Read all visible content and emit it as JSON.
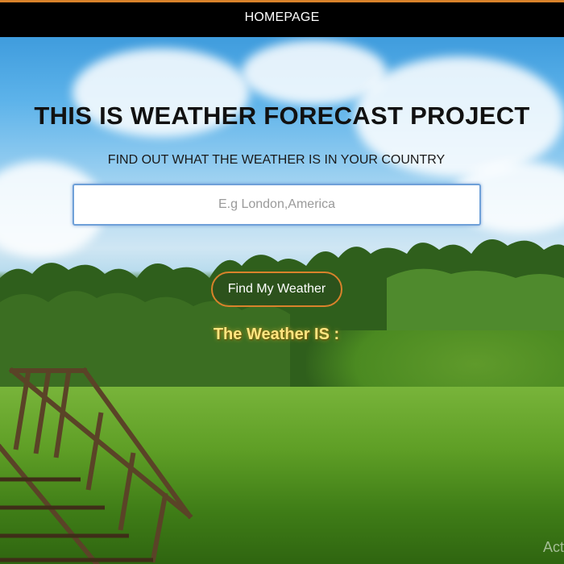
{
  "nav": {
    "home_label": "HOMEPAGE"
  },
  "hero": {
    "title": "THIS IS WEATHER FORECAST PROJECT",
    "subtitle": "FIND OUT WHAT THE WEATHER IS IN YOUR COUNTRY"
  },
  "search": {
    "placeholder": "E.g London,America",
    "value": ""
  },
  "actions": {
    "find_label": "Find My Weather"
  },
  "result": {
    "label": "The Weather IS :"
  },
  "overlay": {
    "watermark": "Acti"
  },
  "colors": {
    "navbar_bg": "#000000",
    "accent": "#d9822b",
    "result_text": "#ffe680",
    "input_border": "#6fa0d8"
  }
}
